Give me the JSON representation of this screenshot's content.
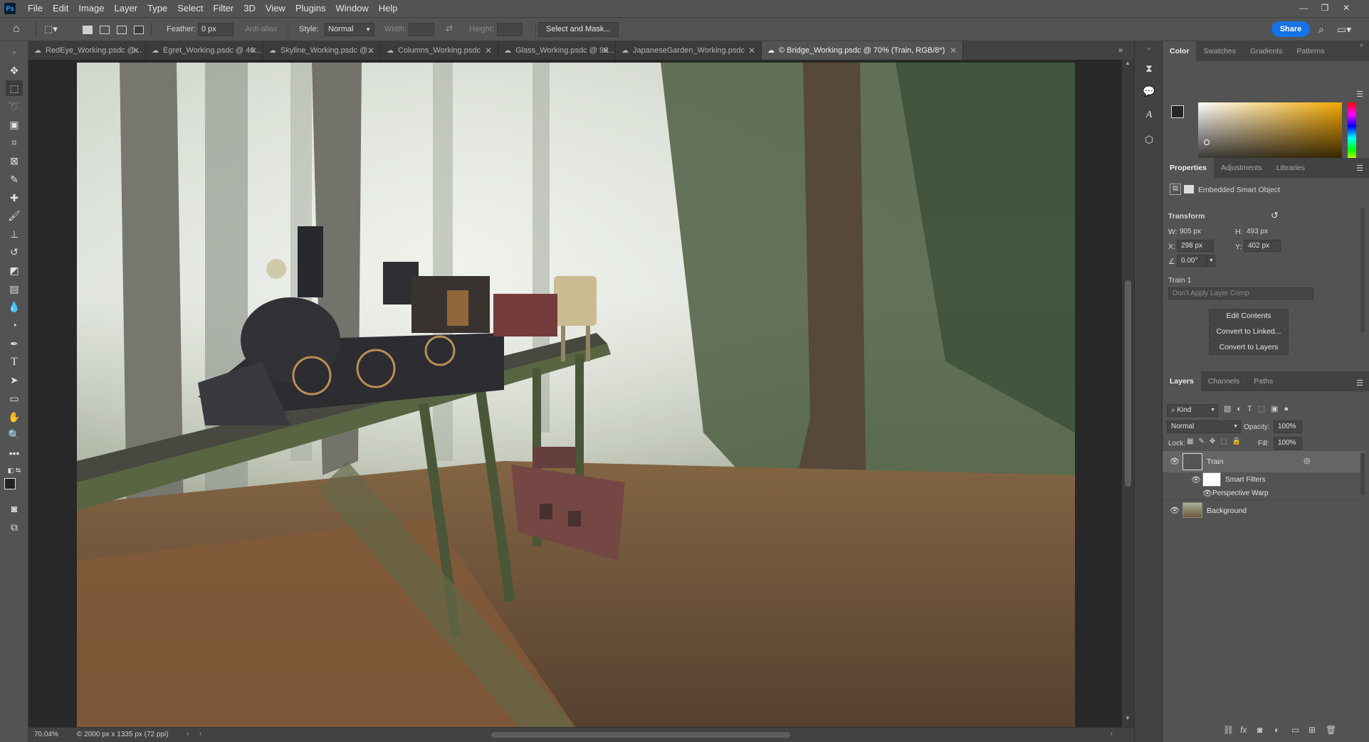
{
  "app": {
    "logo": "Ps",
    "menu": [
      "File",
      "Edit",
      "Image",
      "Layer",
      "Type",
      "Select",
      "Filter",
      "3D",
      "View",
      "Plugins",
      "Window",
      "Help"
    ]
  },
  "options": {
    "feather_label": "Feather:",
    "feather_value": "0 px",
    "anti_alias": "Anti-alias",
    "style_label": "Style:",
    "style_value": "Normal",
    "width_label": "Width:",
    "height_label": "Height:",
    "select_mask": "Select and Mask...",
    "share": "Share"
  },
  "tabs": [
    {
      "label": "RedEye_Working.psdc @..."
    },
    {
      "label": "Egret_Working.psdc @ 46..."
    },
    {
      "label": "Skyline_Working.psdc @..."
    },
    {
      "label": "Columns_Working.psdc"
    },
    {
      "label": "Glass_Working.psdc @ 96..."
    },
    {
      "label": "JapaneseGarden_Working.psdc"
    },
    {
      "label": "© Bridge_Working.psdc @ 70% (Train, RGB/8*)"
    }
  ],
  "status": {
    "zoom": "70.04%",
    "doc_info": "© 2000 px x 1335 px (72 ppi)"
  },
  "color_panel": {
    "tabs": [
      "Color",
      "Swatches",
      "Gradients",
      "Patterns"
    ],
    "hue_color": "#f5a800"
  },
  "properties": {
    "tabs": [
      "Properties",
      "Adjustments",
      "Libraries"
    ],
    "object_type": "Embedded Smart Object",
    "transform_title": "Transform",
    "w_label": "W:",
    "w_value": "905 px",
    "h_label": "H:",
    "h_value": "493 px",
    "x_label": "X:",
    "x_value": "298 px",
    "y_label": "Y:",
    "y_value": "402 px",
    "angle_value": "0.00°",
    "layer_name": "Train 1",
    "layer_comp": "Don't Apply Layer Comp",
    "buttons": [
      "Edit Contents",
      "Convert to Linked...",
      "Convert to Layers"
    ]
  },
  "layers_panel": {
    "tabs": [
      "Layers",
      "Channels",
      "Paths"
    ],
    "kind": "Kind",
    "blend_mode": "Normal",
    "opacity_label": "Opacity:",
    "opacity_value": "100%",
    "lock_label": "Lock:",
    "fill_label": "Fill:",
    "fill_value": "100%",
    "layers": [
      {
        "name": "Train"
      },
      {
        "name": "Smart Filters"
      },
      {
        "name": "Perspective Warp"
      },
      {
        "name": "Background"
      }
    ]
  }
}
